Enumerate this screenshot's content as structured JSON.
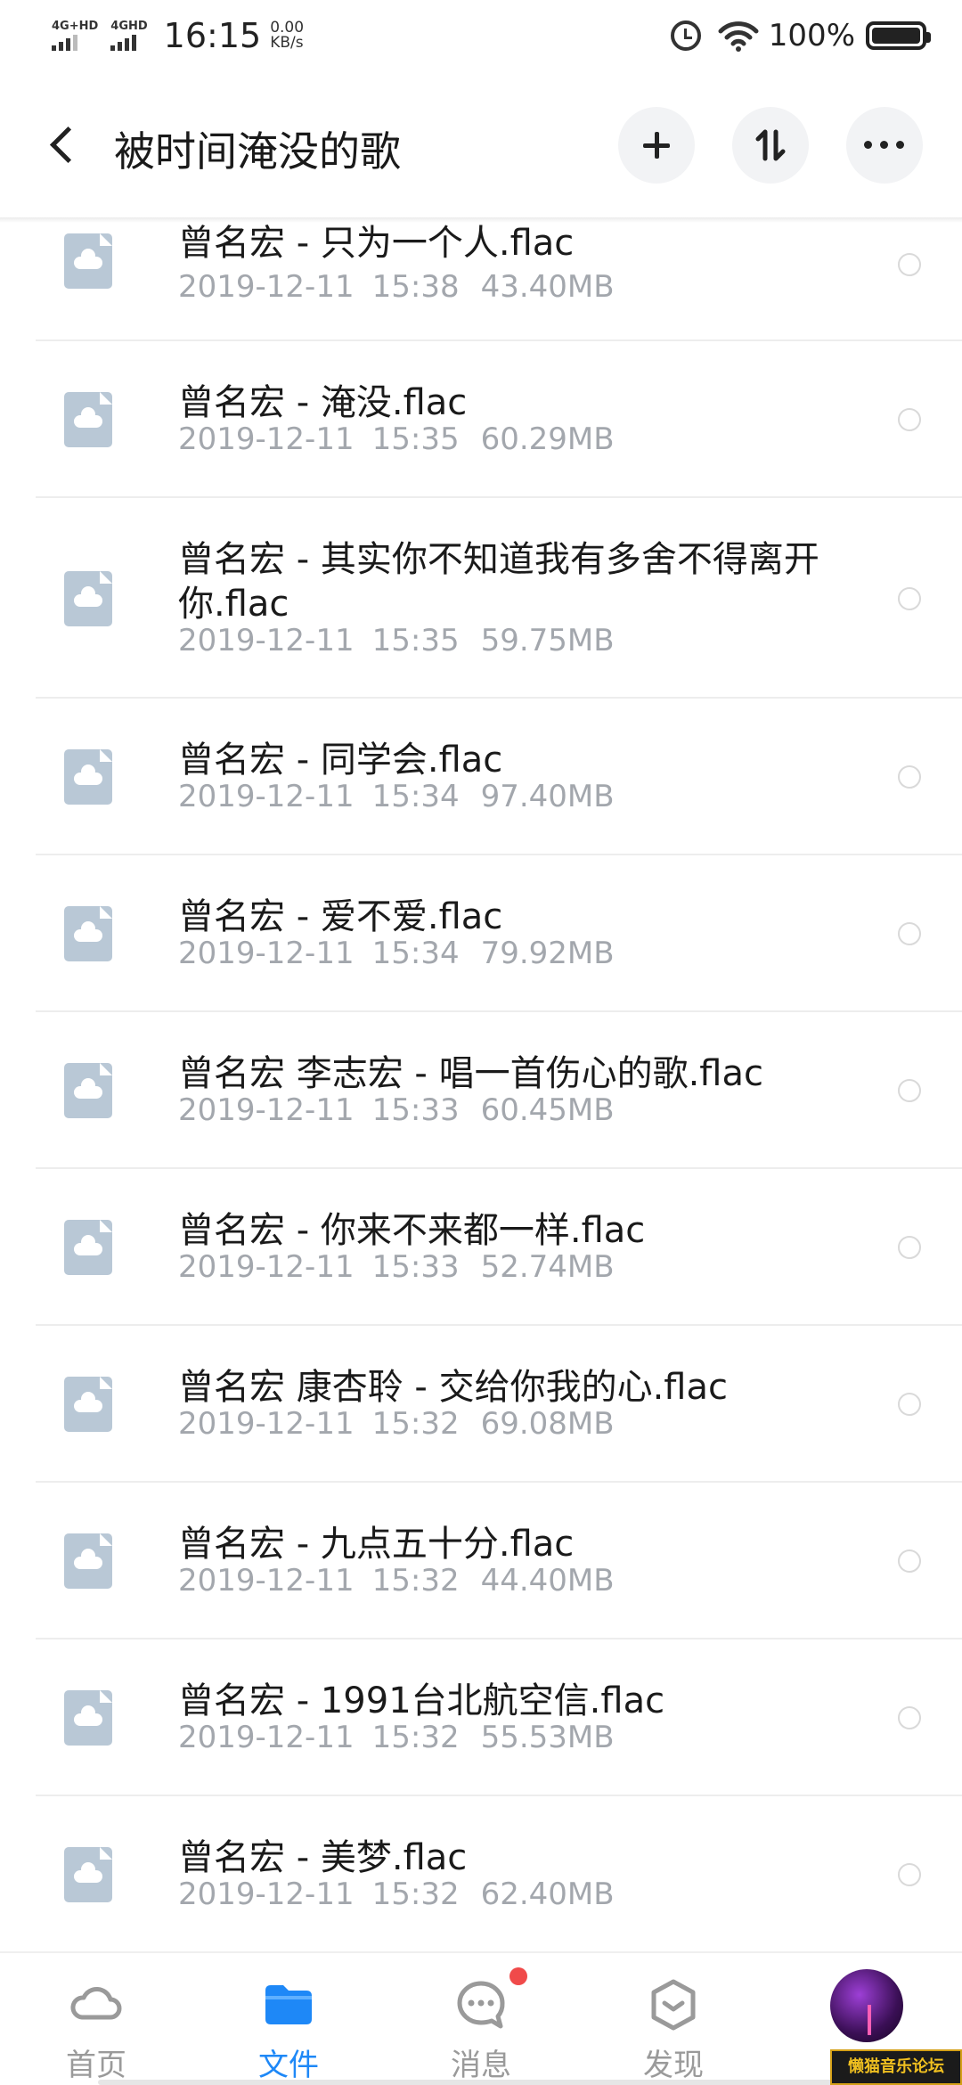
{
  "status_bar": {
    "signal1_label": "4G+HD",
    "signal2_label": "4GHD",
    "time": "16:15",
    "speed_value": "0.00",
    "speed_unit": "KB/s",
    "battery_text": "100%",
    "icons": [
      "alarm-icon",
      "wifi-icon",
      "battery-icon"
    ]
  },
  "header": {
    "back_icon": "chevron-left-icon",
    "title": "被时间淹没的歌",
    "actions": [
      "plus-icon",
      "sort-icon",
      "more-icon"
    ]
  },
  "files": [
    {
      "name": "曾名宏 - 只为一个人.flac",
      "date": "2019-12-11",
      "time": "15:38",
      "size": "43.40MB"
    },
    {
      "name": "曾名宏 - 淹没.flac",
      "date": "2019-12-11",
      "time": "15:35",
      "size": "60.29MB"
    },
    {
      "name": "曾名宏 - 其实你不知道我有多舍不得离开你.flac",
      "date": "2019-12-11",
      "time": "15:35",
      "size": "59.75MB"
    },
    {
      "name": "曾名宏 - 同学会.flac",
      "date": "2019-12-11",
      "time": "15:34",
      "size": "97.40MB"
    },
    {
      "name": "曾名宏 - 爱不爱.flac",
      "date": "2019-12-11",
      "time": "15:34",
      "size": "79.92MB"
    },
    {
      "name": "曾名宏 李志宏 - 唱一首伤心的歌.flac",
      "date": "2019-12-11",
      "time": "15:33",
      "size": "60.45MB"
    },
    {
      "name": "曾名宏 - 你来不来都一样.flac",
      "date": "2019-12-11",
      "time": "15:33",
      "size": "52.74MB"
    },
    {
      "name": "曾名宏 康杏聆 - 交给你我的心.flac",
      "date": "2019-12-11",
      "time": "15:32",
      "size": "69.08MB"
    },
    {
      "name": "曾名宏 - 九点五十分.flac",
      "date": "2019-12-11",
      "time": "15:32",
      "size": "44.40MB"
    },
    {
      "name": "曾名宏 - 1991台北航空信.flac",
      "date": "2019-12-11",
      "time": "15:32",
      "size": "55.53MB"
    },
    {
      "name": "曾名宏 - 美梦.flac",
      "date": "2019-12-11",
      "time": "15:32",
      "size": "62.40MB"
    }
  ],
  "bottom_nav": {
    "items": [
      {
        "label": "首页",
        "icon": "cloud-home-icon"
      },
      {
        "label": "文件",
        "icon": "folder-icon",
        "active": true
      },
      {
        "label": "消息",
        "icon": "message-icon",
        "badge": true
      },
      {
        "label": "发现",
        "icon": "discover-icon"
      }
    ],
    "avatar": "avatar"
  },
  "watermark": "懒猫音乐论坛",
  "colors": {
    "accent": "#1e88f7",
    "file_icon": "#b9c8d6",
    "meta_text": "#a3a7ad",
    "badge": "#f04a4a"
  }
}
